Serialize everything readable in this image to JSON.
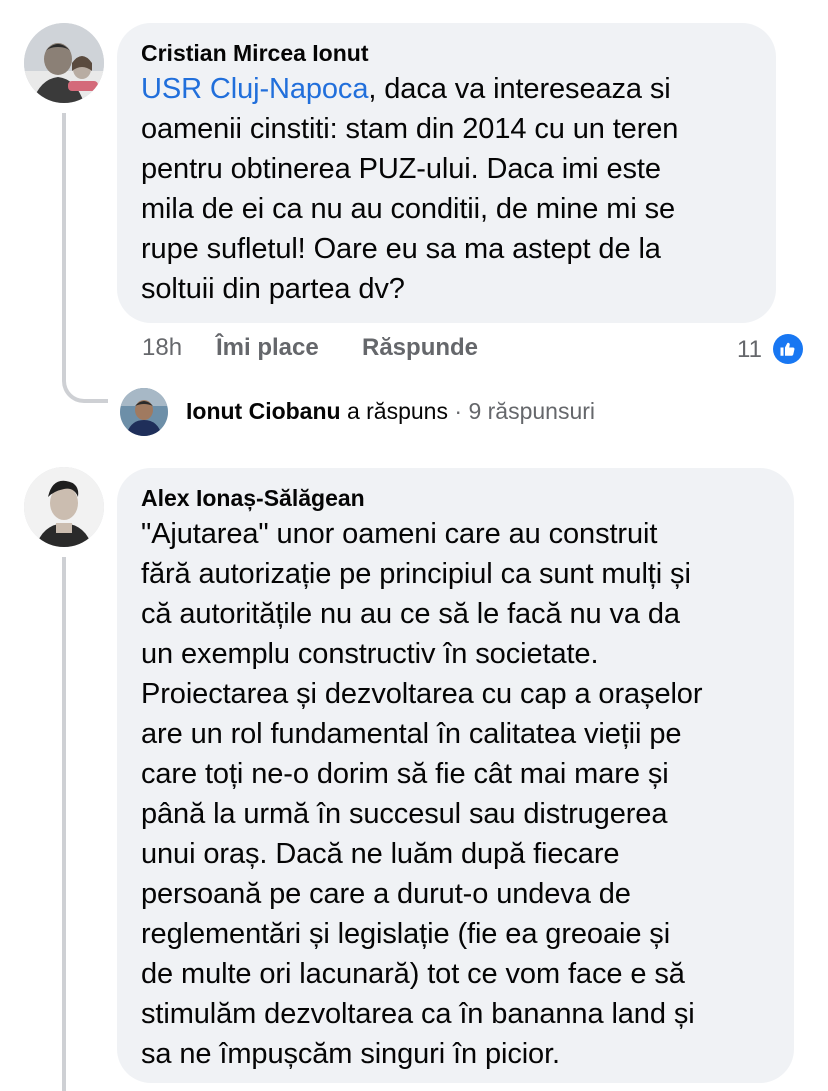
{
  "comments": [
    {
      "author": "Cristian Mircea Ionut",
      "mention": "USR Cluj-Napoca",
      "text_lines": [
        ", daca va intereseaza si",
        "oamenii cinstiti: stam din 2014 cu un teren",
        "pentru obtinerea PUZ-ului. Daca imi este",
        "mila de ei ca nu au conditii, de mine mi se",
        "rupe sufletul! Oare eu sa ma astept de la",
        "soltuii din partea dv?"
      ],
      "time": "18h",
      "like_label": "Îmi place",
      "reply_label": "Răspunde",
      "reaction_count": "11",
      "reaction_icon": "thumbs-up-icon",
      "reply_summary": {
        "author": "Ionut Ciobanu",
        "verb": "a răspuns",
        "separator": "·",
        "count": "9 răspunsuri"
      }
    },
    {
      "author": "Alex Ionaș-Sălăgean",
      "text_lines": [
        "\"Ajutarea\" unor oameni care au construit",
        "fără autorizație pe principiul ca sunt mulți și",
        "că autoritățile nu au ce să le facă nu va da",
        "un exemplu constructiv în societate.",
        "Proiectarea și dezvoltarea cu cap a orașelor",
        "are un rol fundamental în calitatea vieții pe",
        "care toți ne-o dorim să fie cât mai mare și",
        "până la urmă în succesul sau distrugerea",
        "unui oraș. Dacă ne luăm după fiecare",
        "persoană pe care a durut-o undeva de",
        "reglementări și legislație (fie ea greoaie și",
        "de multe ori lacunară) tot ce vom face e să",
        "stimulăm dezvoltarea ca în bananna land și",
        "sa ne împușcăm singuri în picior."
      ]
    }
  ],
  "colors": {
    "bubble": "#f0f2f5",
    "mention": "#216fdb",
    "meta": "#65676b",
    "like_blue": "#1877f2",
    "thread_line": "#ced0d4"
  }
}
